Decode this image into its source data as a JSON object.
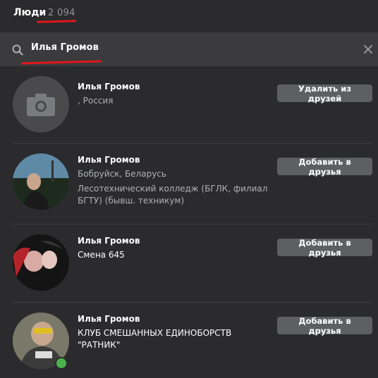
{
  "header": {
    "title": "Люди",
    "count": "2 094"
  },
  "search": {
    "value": "Илья Громов",
    "icon": "search-icon",
    "clear_icon": "close-icon"
  },
  "results": [
    {
      "name": "Илья Громов",
      "line1": ", Россия",
      "line2": "",
      "button": "Удалить из друзей",
      "avatar": "camera-placeholder",
      "online": false
    },
    {
      "name": "Илья Громов",
      "line1": "Бобруйск, Беларусь",
      "line2": "Лесотехнический колледж (БГЛК, филиал БГТУ) (бывш. техникум)",
      "button": "Добавить в друзья",
      "avatar": "photo",
      "online": false
    },
    {
      "name": "Илья Громов",
      "line1": "Смена 645",
      "line2": "",
      "button": "Добавить в друзья",
      "avatar": "photo",
      "online": false
    },
    {
      "name": "Илья Громов",
      "line1": "КЛУБ СМЕШАННЫХ ЕДИНОБОРСТВ \"РАТНИК\"",
      "line2": "",
      "button": "Добавить в друзья",
      "avatar": "photo",
      "online": true
    }
  ],
  "colors": {
    "background": "#2b2b2d",
    "searchbar": "#3b3b3d",
    "button": "#5d5f61",
    "annotation_red": "#e0171c",
    "online": "#4bb34b"
  }
}
